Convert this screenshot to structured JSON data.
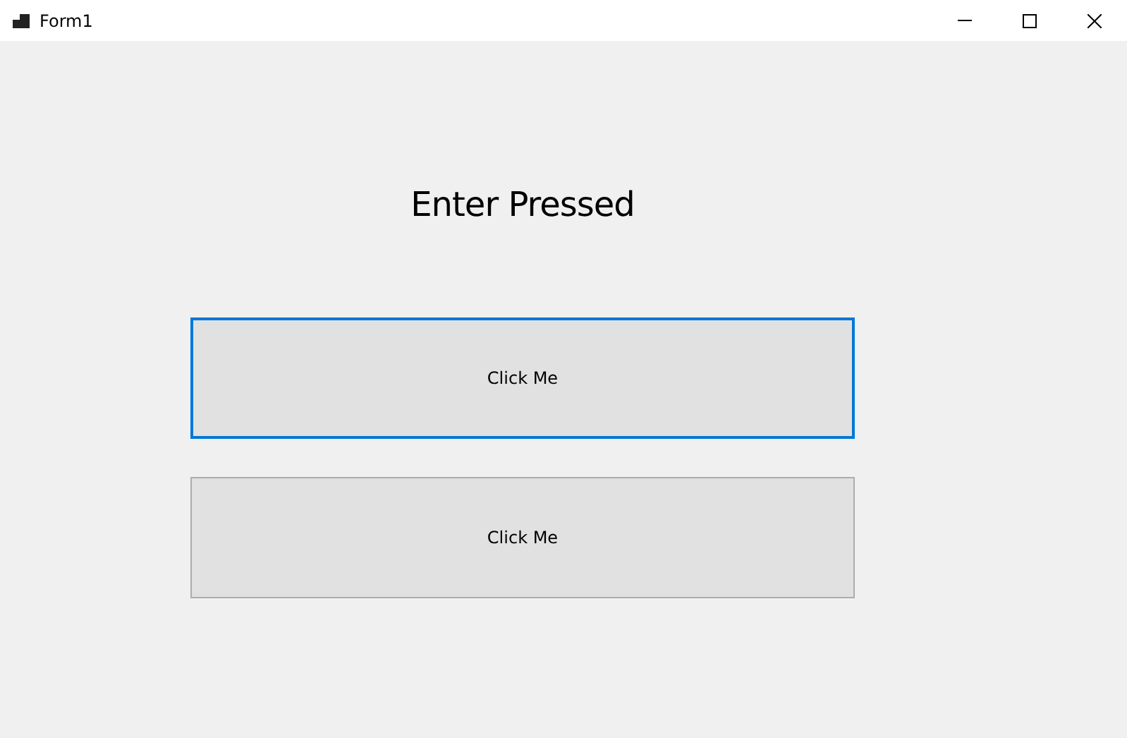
{
  "window": {
    "title": "Form1"
  },
  "label": "Enter Pressed",
  "buttons": [
    {
      "label": "Click Me",
      "focused": true
    },
    {
      "label": "Click Me",
      "focused": false
    }
  ]
}
